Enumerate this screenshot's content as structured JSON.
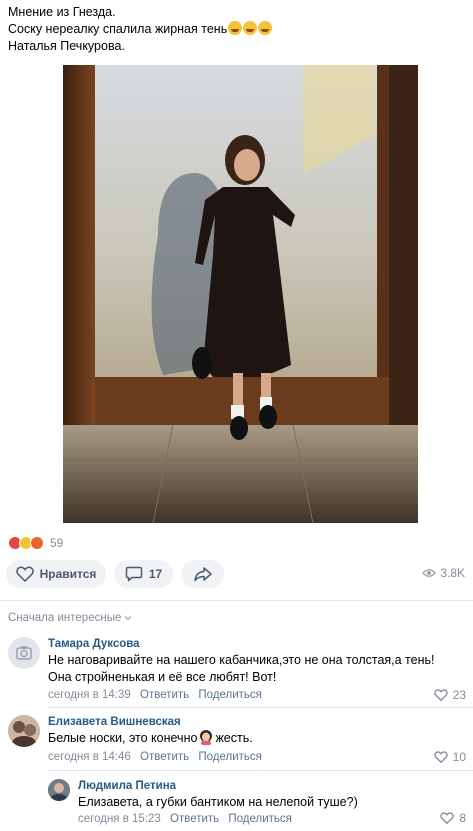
{
  "post": {
    "line1": "Мнение из Гнезда.",
    "line2": "Соску нереалку спалила жирная тень",
    "line3": "Наталья Печкурова."
  },
  "reactions": {
    "count": "59",
    "icons": [
      "heart-icon",
      "laugh-icon",
      "angry-icon"
    ]
  },
  "actions": {
    "like_label": "Нравится",
    "comment_count": "17",
    "views": "3.8K"
  },
  "comments": {
    "sort_label": "Сначала интересные",
    "items": [
      {
        "author": "Тамара Дуксова",
        "text": "Не наговаривайте на нашего кабанчика,это не она толстая,а тень! Она стройненькая и её все любят! Вот!",
        "time": "сегодня в 14:39",
        "reply": "Ответить",
        "share": "Поделиться",
        "likes": "23"
      },
      {
        "author": "Елизавета Вишневская",
        "text_before": "Белые носки, это конечно",
        "text_after": "жесть.",
        "time": "сегодня в 14:46",
        "reply": "Ответить",
        "share": "Поделиться",
        "likes": "10"
      },
      {
        "author": "Людмила Петина",
        "text": "Елизавета, а губки бантиком на нелепой туше?)",
        "time": "сегодня в 15:23",
        "reply": "Ответить",
        "share": "Поделиться",
        "likes": "8"
      }
    ]
  },
  "colors": {
    "link": "#2a5885",
    "secondary": "#818c99",
    "button_bg": "#f0f2f5"
  }
}
